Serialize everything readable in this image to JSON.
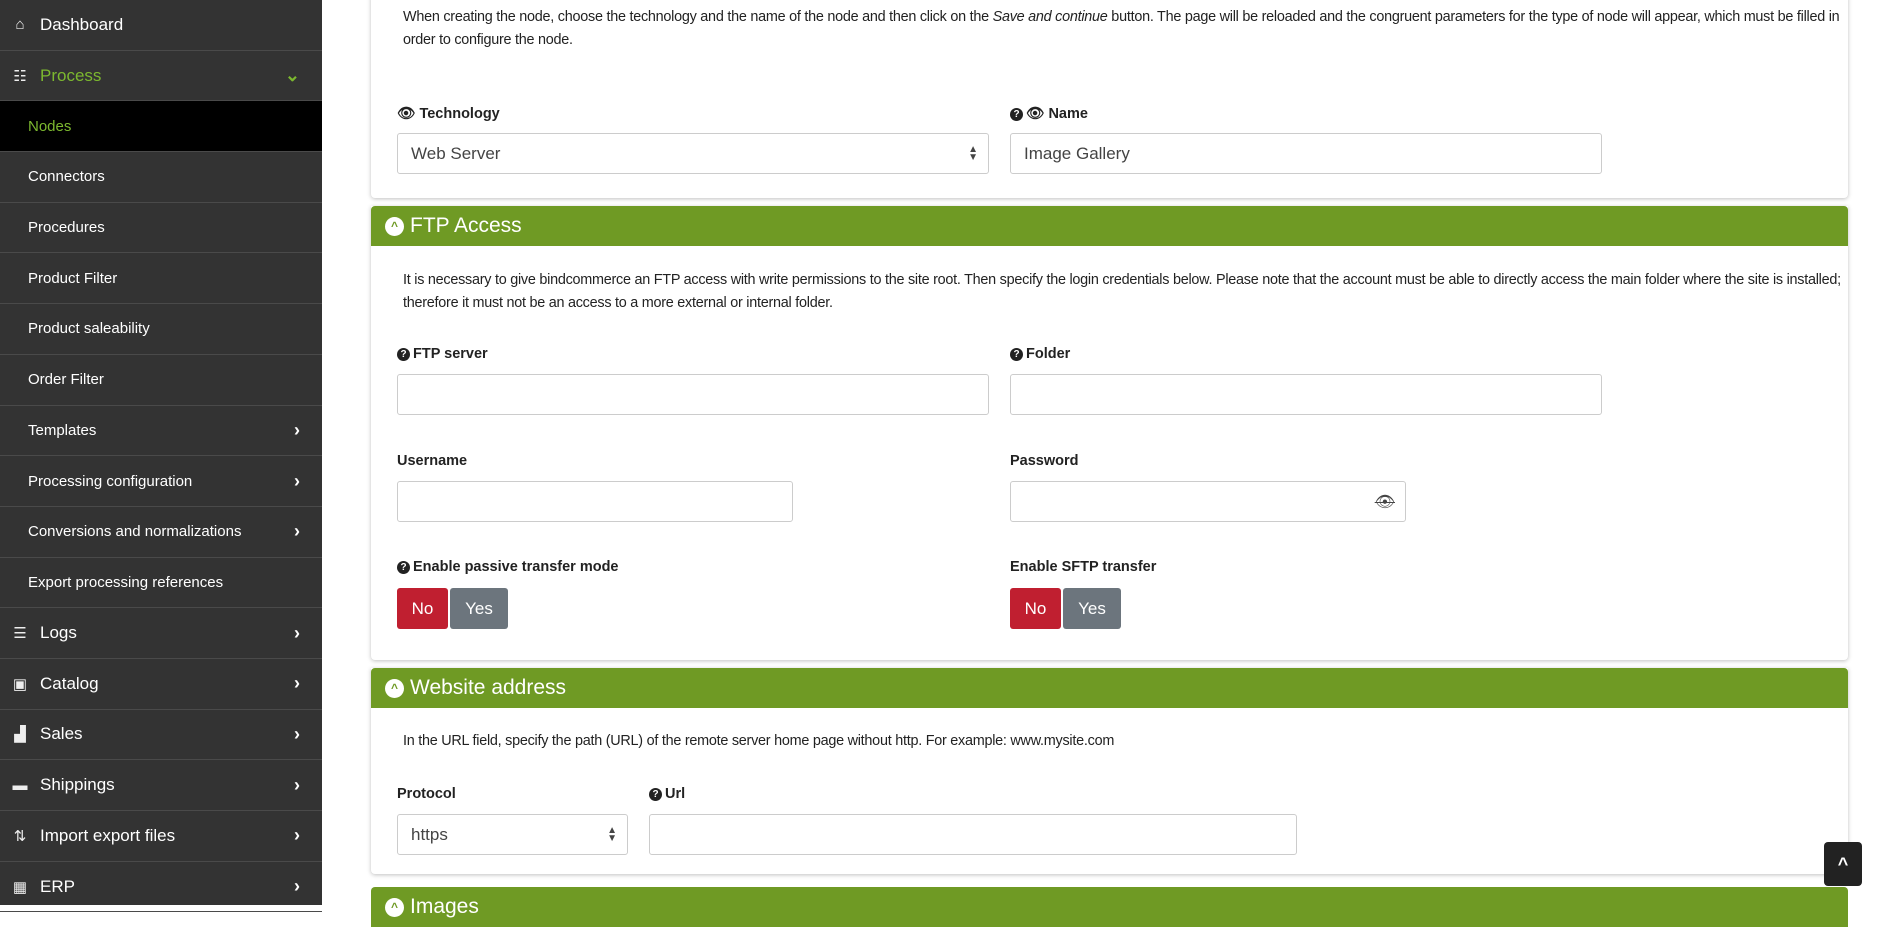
{
  "sidebar": {
    "items": [
      {
        "label": "Dashboard",
        "icon": "home-icon"
      },
      {
        "label": "Process",
        "icon": "process-icon"
      },
      {
        "label": "Nodes"
      },
      {
        "label": "Connectors"
      },
      {
        "label": "Procedures"
      },
      {
        "label": "Product Filter"
      },
      {
        "label": "Product saleability"
      },
      {
        "label": "Order Filter"
      },
      {
        "label": "Templates"
      },
      {
        "label": "Processing configuration"
      },
      {
        "label": "Conversions and normalizations"
      },
      {
        "label": "Export processing references"
      },
      {
        "label": "Logs",
        "icon": "logs-icon"
      },
      {
        "label": "Catalog",
        "icon": "box-icon"
      },
      {
        "label": "Sales",
        "icon": "chart-icon"
      },
      {
        "label": "Shippings",
        "icon": "truck-icon"
      },
      {
        "label": "Import export files",
        "icon": "arrows-icon"
      },
      {
        "label": "ERP",
        "icon": "erp-icon"
      }
    ]
  },
  "intro": {
    "text_before": "When creating the node, choose the technology and the name of the node and then click on the ",
    "text_em": "Save and continue",
    "text_after": " button. The page will be reloaded and the congruent parameters for the type of node will appear, which must be filled in order to configure the node.",
    "technology_label": "Technology",
    "technology_value": "Web Server",
    "name_label": "Name",
    "name_value": "Image Gallery"
  },
  "ftp": {
    "title": "FTP Access",
    "text": "It is necessary to give bindcommerce an FTP access with write permissions to the site root. Then specify the login credentials below. Please note that the account must be able to directly access the main folder where the site is installed; therefore it must not be an access to a more external or internal folder.",
    "server_label": "FTP server",
    "folder_label": "Folder",
    "username_label": "Username",
    "password_label": "Password",
    "passive_label": "Enable passive transfer mode",
    "sftp_label": "Enable SFTP transfer",
    "no": "No",
    "yes": "Yes",
    "passive_value": "No",
    "sftp_value": "No"
  },
  "website": {
    "title": "Website address",
    "text": "In the URL field, specify the path (URL) of the remote server home page without http. For example: www.mysite.com",
    "protocol_label": "Protocol",
    "protocol_value": "https",
    "url_label": "Url"
  },
  "images": {
    "title": "Images"
  },
  "colors": {
    "accent": "#6f9a24",
    "no_active": "#c01f30",
    "inactive": "#6c757d",
    "sidebar": "#333333"
  }
}
